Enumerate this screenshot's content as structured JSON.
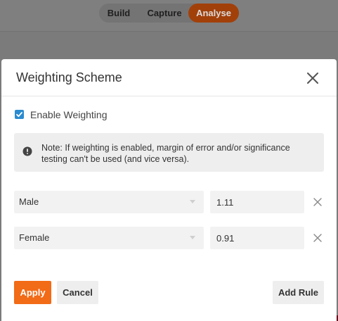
{
  "nav": {
    "tabs": [
      {
        "label": "Build"
      },
      {
        "label": "Capture"
      },
      {
        "label": "Analyse",
        "active": true
      }
    ]
  },
  "modal": {
    "title": "Weighting Scheme",
    "enable_weighting": {
      "label": "Enable Weighting",
      "checked": true
    },
    "notice": "Note: If weighting is enabled, margin of error and/or significance testing can't be used (and vice versa).",
    "rules": [
      {
        "group": "Male",
        "weight": "1.11"
      },
      {
        "group": "Female",
        "weight": "0.91"
      }
    ],
    "buttons": {
      "apply": "Apply",
      "cancel": "Cancel",
      "add_rule": "Add Rule"
    }
  },
  "colors": {
    "accent": "#f26b16",
    "checkbox": "#2a8bd0",
    "active_tab_dimmed": "#a2400a"
  },
  "icons": {
    "close": "close-icon",
    "notice": "exclamation-circle-icon",
    "remove": "remove-rule-icon",
    "dropdown": "caret-down-icon",
    "check": "check-icon"
  }
}
